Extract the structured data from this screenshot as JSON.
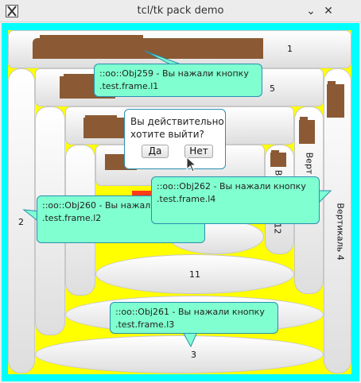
{
  "window": {
    "title": "tcl/tk pack demo",
    "minimize_glyph": "⌄",
    "close_glyph": "✕"
  },
  "colors": {
    "outer_frame": "#00ffff",
    "inner_frame": "#ffff00",
    "tooltip_bg": "#80ffd0",
    "tooltip_border": "#2a8fb0",
    "chip": "#8b5a34",
    "red_chip": "#ff3b1a"
  },
  "buttons": {
    "b1": "1",
    "b2": "2",
    "b3": "3",
    "b5": "5",
    "b11": "11",
    "v_label": "Вертикаль 4",
    "v_label_short": "Верт",
    "v_label_12": "12",
    "v_label_b": "В"
  },
  "tooltips": {
    "l1": {
      "line1": "::oo::Obj259 - Вы нажали кнопку",
      "line2": ".test.frame.l1"
    },
    "l2": {
      "line1": "::oo::Obj260 - Вы нажали",
      "line2": ".test.frame.l2"
    },
    "l3": {
      "line1": "::oo::Obj261 - Вы нажали кнопку",
      "line2": ".test.frame.l3"
    },
    "l4": {
      "line1": "::oo::Obj262 - Вы нажали кнопку",
      "line2": ".test.frame.l4"
    }
  },
  "dialog": {
    "line1": "Вы действительно",
    "line2": "хотите выйти?",
    "yes": "Да",
    "no": "Нет"
  },
  "icons": {
    "app_icon": "x-window-icon",
    "cursor": "mouse-pointer-icon"
  }
}
